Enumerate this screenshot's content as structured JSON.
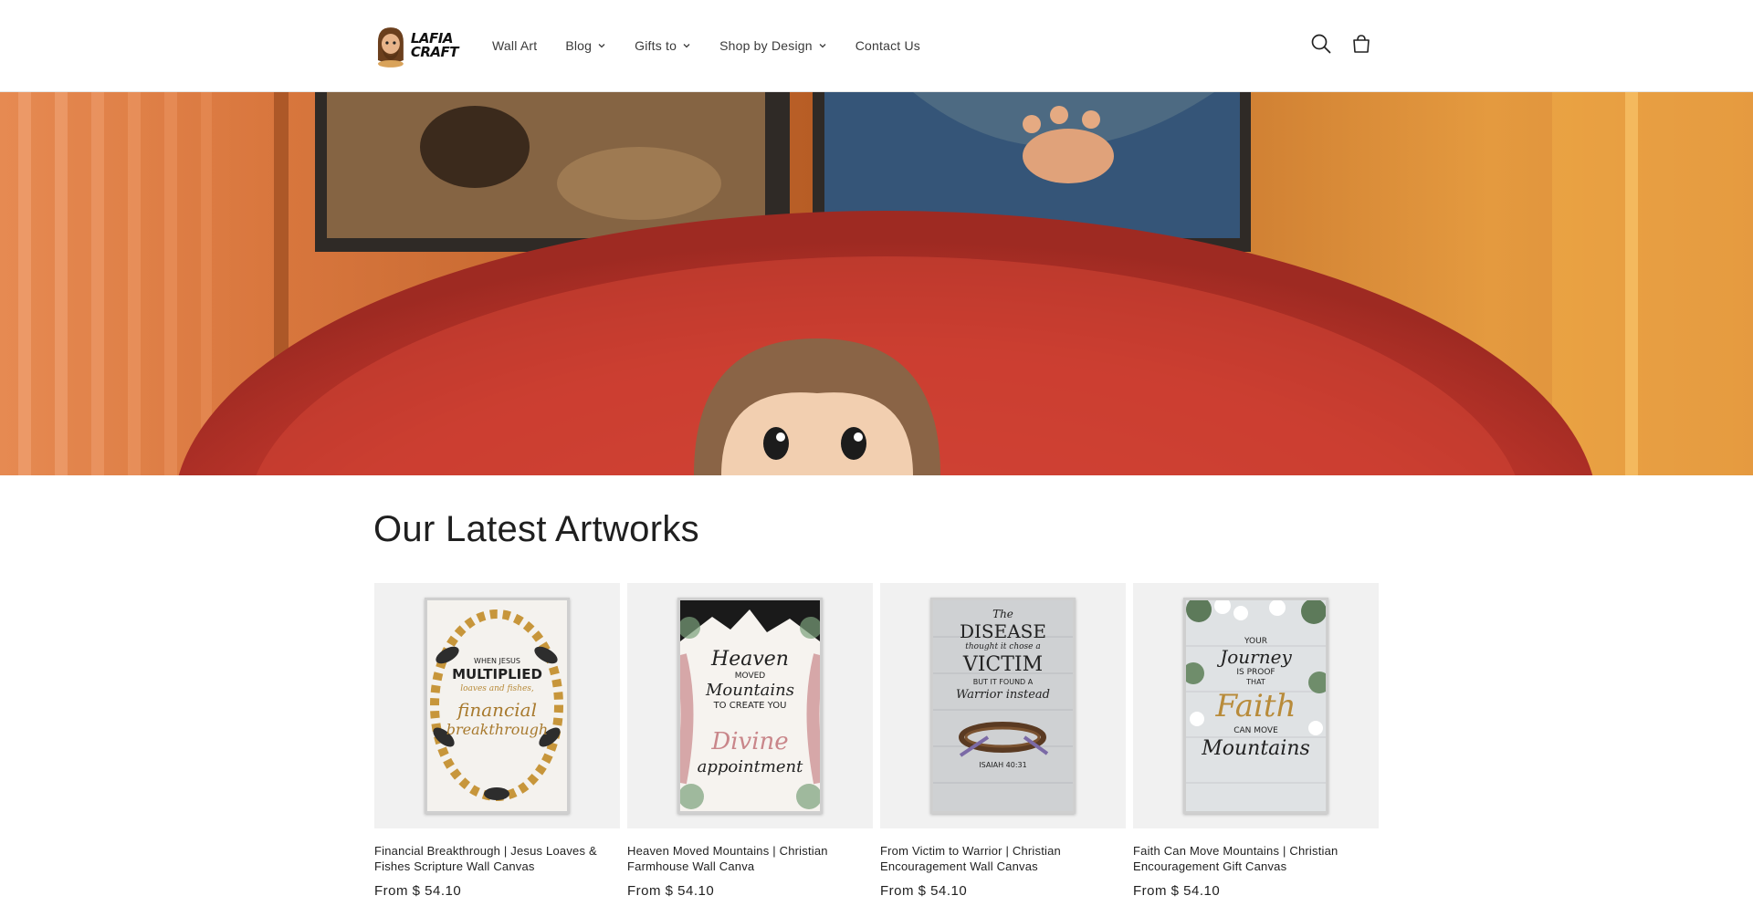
{
  "brand": {
    "logo_line1": "LAFIA",
    "logo_line2": "CRAFT"
  },
  "nav": {
    "items": [
      {
        "label": "Wall Art",
        "has_dropdown": false
      },
      {
        "label": "Blog",
        "has_dropdown": true
      },
      {
        "label": "Gifts to",
        "has_dropdown": true
      },
      {
        "label": "Shop by Design",
        "has_dropdown": true
      },
      {
        "label": "Contact Us",
        "has_dropdown": false
      }
    ]
  },
  "header_icons": {
    "search": "search-icon",
    "cart": "cart-icon"
  },
  "section": {
    "title": "Our Latest Artworks"
  },
  "products": [
    {
      "title": "Financial Breakthrough | Jesus Loaves & Fishes Scripture Wall Canvas",
      "price": "From $ 54.10",
      "poster_lines": [
        "WHEN JESUS",
        "MULTIPLIED",
        "loaves and fishes,",
        "financial",
        "breakthrough"
      ]
    },
    {
      "title": "Heaven Moved Mountains | Christian Farmhouse Wall Canva",
      "price": "From $ 54.10",
      "poster_lines": [
        "Heaven",
        "MOVED",
        "Mountains",
        "TO CREATE YOU",
        "Divine",
        "appointment"
      ]
    },
    {
      "title": "From Victim to Warrior | Christian Encouragement Wall Canvas",
      "price": "From $ 54.10",
      "poster_lines": [
        "The",
        "DISEASE",
        "thought it chose a",
        "VICTIM",
        "BUT IT FOUND A",
        "Warrior instead",
        "ISAIAH 40:31"
      ]
    },
    {
      "title": "Faith Can Move Mountains | Christian Encouragement Gift Canvas",
      "price": "From $ 54.10",
      "poster_lines": [
        "YOUR",
        "Journey",
        "IS PROOF",
        "THAT",
        "Faith",
        "CAN MOVE",
        "Mountains"
      ]
    }
  ],
  "colors": {
    "text": "#1f1f1f",
    "card_bg": "#f1f1f1",
    "pink": "#c9868a",
    "gold": "#b88b3a"
  }
}
